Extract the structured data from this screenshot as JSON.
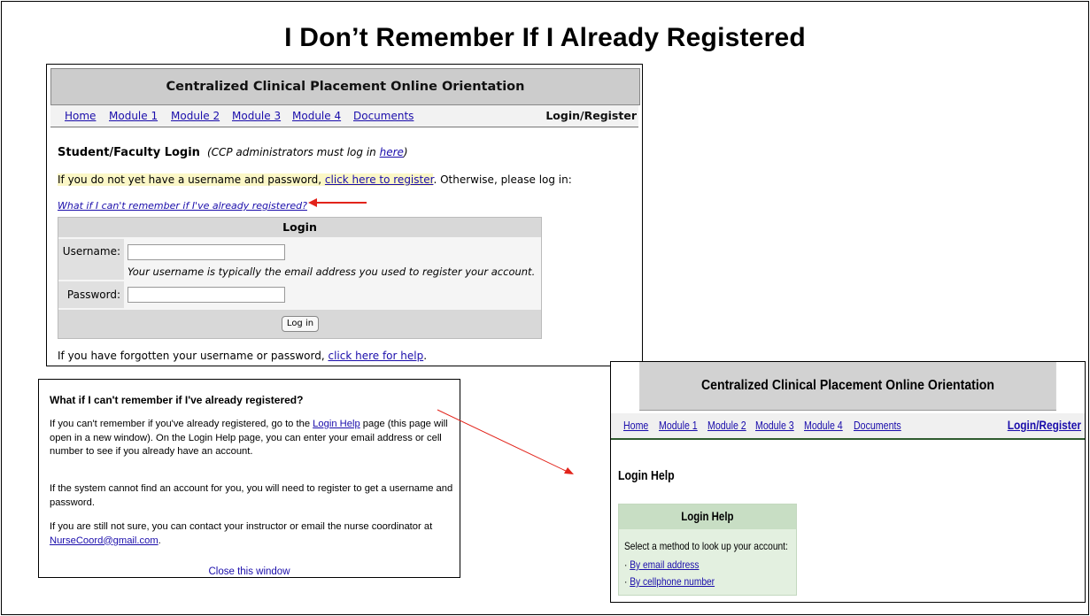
{
  "slide": {
    "title": "I Don’t Remember If I Already Registered"
  },
  "login_page": {
    "header_title": "Centralized Clinical Placement Online Orientation",
    "nav": [
      "Home",
      "Module 1",
      "Module 2",
      "Module 3",
      "Module 4",
      "Documents"
    ],
    "nav_current": "Login/Register",
    "section_title": "Student/Faculty Login",
    "admin_note_prefix": "(CCP administrators must log in ",
    "admin_note_link": "here",
    "admin_note_suffix": ")",
    "register_prefix": "If you do not yet have a username and password, ",
    "register_link": "click here to register",
    "register_suffix": ". Otherwise, please log in:",
    "whatif_link": "What if I can't remember if I've already registered?",
    "form": {
      "title": "Login",
      "username_label": "Username:",
      "username_value": "",
      "username_hint": "Your username is typically the email address you used to register your account.",
      "password_label": "Password:",
      "password_value": "",
      "submit_label": "Log in"
    },
    "forgot_prefix": "If you have forgotten your username or password, ",
    "forgot_link": "click here for help",
    "forgot_suffix": "."
  },
  "popup": {
    "title": "What if I can't remember if I've already registered?",
    "para1_prefix": "If you can't remember if you've already registered, go to the ",
    "para1_link": "Login Help",
    "para1_suffix": " page (this page will open in a new window). On the Login Help page, you can enter your email address or cell number to see if you already have an account.",
    "para2": "If the system cannot find an account for you, you will need to register to get a username and password.",
    "para3_prefix": "If you are still not sure, you can contact your instructor or email the nurse coordinator at ",
    "para3_link": "NurseCoord@gmail.com",
    "para3_suffix": ".",
    "close_link": "Close this window"
  },
  "help_page": {
    "header_title": "Centralized Clinical Placement Online Orientation",
    "nav": [
      "Home",
      "Module 1",
      "Module 2",
      "Module 3",
      "Module 4",
      "Documents"
    ],
    "nav_current": "Login/Register",
    "page_title": "Login Help",
    "panel_title": "Login Help",
    "instruction": "Select a method to look up your account:",
    "options": [
      "By email address",
      "By cellphone number"
    ],
    "option_bullet": "·"
  },
  "colors": {
    "link": "#1a0dab",
    "annotation_arrow": "#e2231a",
    "header_gray": "#cccccc",
    "panel_green": "#e3f0e0"
  }
}
